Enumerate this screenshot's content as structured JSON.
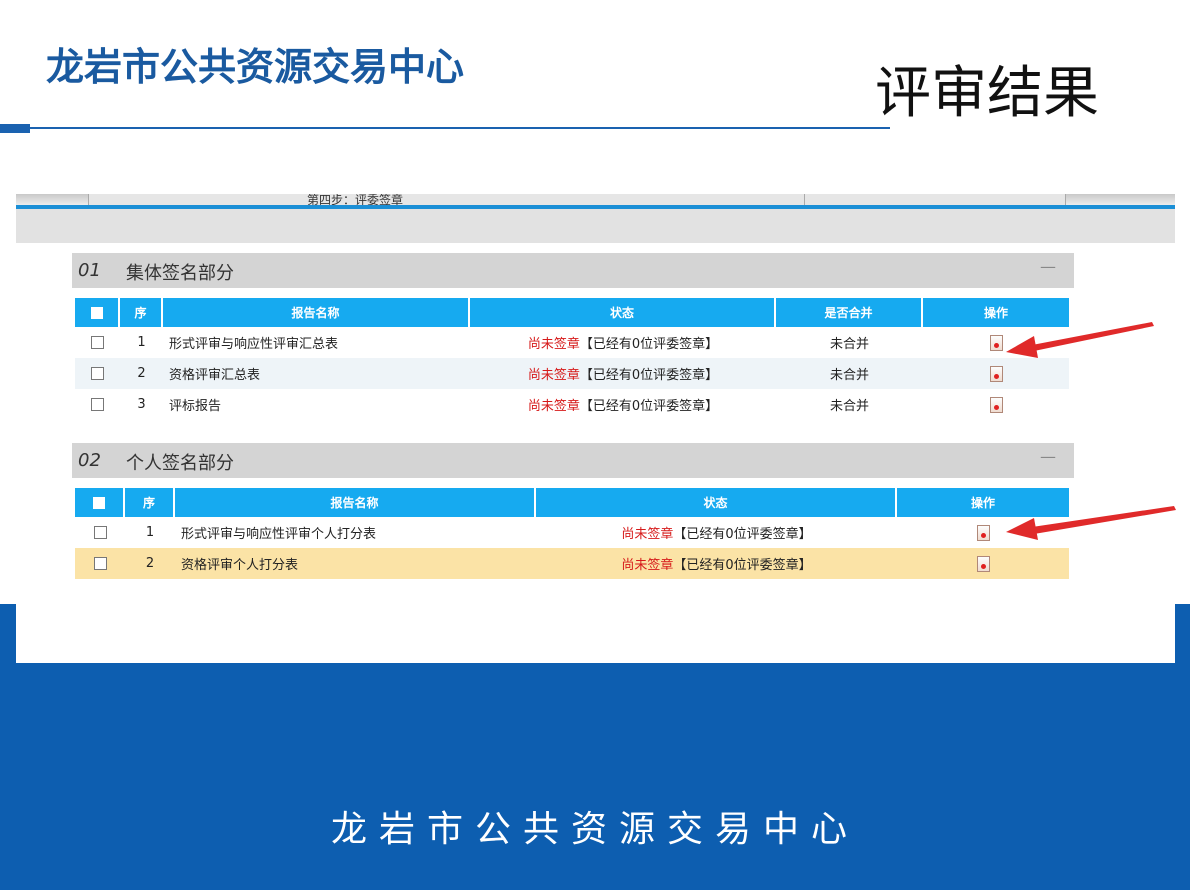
{
  "slide": {
    "org_title": "龙岩市公共资源交易中心",
    "title": "评审结果",
    "footer": "龙岩市公共资源交易中心"
  },
  "embedded": {
    "tab_label": "第四步：评委签章",
    "sections": [
      {
        "num": "01",
        "title": "集体签名部分",
        "collapse_symbol": "—",
        "columns": [
          "序",
          "报告名称",
          "状态",
          "是否合并",
          "操作"
        ],
        "rows": [
          {
            "seq": "1",
            "name": "形式评审与响应性评审汇总表",
            "status_red": "尚未签章",
            "status_rest": "【已经有0位评委签章】",
            "merged": "未合并"
          },
          {
            "seq": "2",
            "name": "资格评审汇总表",
            "status_red": "尚未签章",
            "status_rest": "【已经有0位评委签章】",
            "merged": "未合并"
          },
          {
            "seq": "3",
            "name": "评标报告",
            "status_red": "尚未签章",
            "status_rest": "【已经有0位评委签章】",
            "merged": "未合并"
          }
        ]
      },
      {
        "num": "02",
        "title": "个人签名部分",
        "collapse_symbol": "—",
        "columns": [
          "序",
          "报告名称",
          "状态",
          "操作"
        ],
        "rows": [
          {
            "seq": "1",
            "name": "形式评审与响应性评审个人打分表",
            "status_red": "尚未签章",
            "status_rest": "【已经有0位评委签章】"
          },
          {
            "seq": "2",
            "name": "资格评审个人打分表",
            "status_red": "尚未签章",
            "status_rest": "【已经有0位评委签章】"
          }
        ]
      }
    ]
  },
  "colors": {
    "brand_blue": "#0d5eb0",
    "table_header": "#16aaf0",
    "status_red": "#d61a1a",
    "highlight_row": "#fbe3a6",
    "annotation_arrow": "#e02a2a"
  },
  "icons": {
    "sign_action": "document-seal-icon",
    "annotation": "red-arrow-icon"
  }
}
